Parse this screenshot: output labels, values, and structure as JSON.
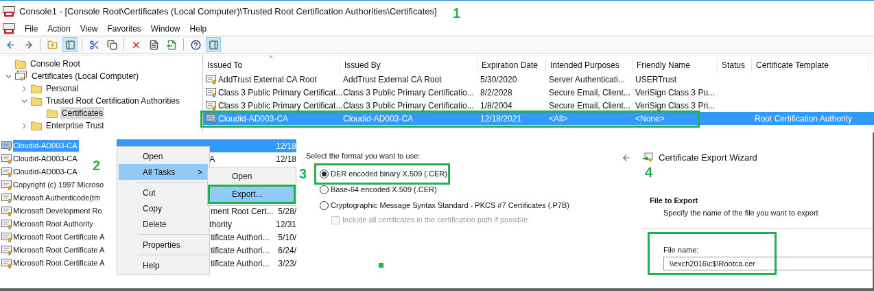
{
  "window": {
    "title": "Console1 - [Console Root\\Certificates (Local Computer)\\Trusted Root Certification Authorities\\Certificates]",
    "step": "1"
  },
  "menu": [
    "File",
    "Action",
    "View",
    "Favorites",
    "Window",
    "Help"
  ],
  "toolbar": [
    {
      "kind": "back",
      "pressed": false
    },
    {
      "kind": "forward",
      "pressed": false
    },
    {
      "kind": "separator"
    },
    {
      "kind": "up",
      "pressed": false
    },
    {
      "kind": "tree",
      "pressed": true
    },
    {
      "kind": "separator"
    },
    {
      "kind": "cut",
      "pressed": false
    },
    {
      "kind": "copy",
      "pressed": false
    },
    {
      "kind": "separator"
    },
    {
      "kind": "delete",
      "pressed": false
    },
    {
      "kind": "properties",
      "pressed": false
    },
    {
      "kind": "export",
      "pressed": false
    },
    {
      "kind": "separator"
    },
    {
      "kind": "help",
      "pressed": false
    },
    {
      "kind": "action-pane",
      "pressed": true
    }
  ],
  "tree": [
    {
      "label": "Console Root",
      "kind": "folder",
      "selected": false
    },
    {
      "label": "Certificates (Local Computer)",
      "kind": "store",
      "expanded": true,
      "selected": false,
      "children": [
        {
          "label": "Personal",
          "kind": "folder",
          "expanded": false,
          "selected": false
        },
        {
          "label": "Trusted Root Certification Authorities",
          "kind": "folder",
          "expanded": true,
          "selected": false,
          "children": [
            {
              "label": "Certificates",
              "kind": "folder",
              "selected": true
            }
          ]
        },
        {
          "label": "Enterprise Trust",
          "kind": "folder",
          "expanded": false,
          "selected": false
        }
      ]
    }
  ],
  "list": {
    "sort_indicator": "^",
    "columns": [
      "Issued To",
      "Issued By",
      "Expiration Date",
      "Intended Purposes",
      "Friendly Name",
      "Status",
      "Certificate Template"
    ],
    "rows": [
      {
        "cells": [
          "AddTrust External CA Root",
          "AddTrust External CA Root",
          "5/30/2020",
          "Server Authenticati...",
          "USERTrust",
          "",
          ""
        ],
        "selected": false,
        "annotated": false
      },
      {
        "cells": [
          "Class 3 Public Primary Certificat...",
          "Class 3 Public Primary Certificatio...",
          "8/2/2028",
          "Secure Email, Client...",
          "VeriSign Class 3 Pu...",
          "",
          ""
        ],
        "selected": false,
        "annotated": false
      },
      {
        "cells": [
          "Class 3 Public Primary Certificat...",
          "Class 3 Public Primary Certificatio...",
          "1/8/2004",
          "Secure Email, Client...",
          "VeriSign Class 3 Pri...",
          "",
          ""
        ],
        "selected": false,
        "annotated": false
      },
      {
        "cells": [
          "Cloudid-AD003-CA",
          "Cloudid-AD003-CA",
          "12/18/2021",
          "<All>",
          "<None>",
          "",
          "Root Certification Authority"
        ],
        "selected": true,
        "annotated": true
      }
    ]
  },
  "context_panel": {
    "step": "2",
    "rows": [
      {
        "issued_to": "Cloudid-AD003-CA",
        "column_2": "",
        "column_3": "12/18",
        "selected": true
      },
      {
        "issued_to": "Cloudid-AD003-CA",
        "column_2": "A",
        "column_3": "12/18",
        "selected": false
      },
      {
        "issued_to": "Cloudid-AD003-CA",
        "column_2": "",
        "column_3": "",
        "selected": false
      },
      {
        "issued_to": "Copyright (c) 1997 Microso",
        "column_2": "",
        "column_3": "",
        "selected": false
      },
      {
        "issued_to": "Microsoft Authenticode(tm",
        "column_2": "",
        "column_3": "",
        "selected": false
      },
      {
        "issued_to": "Microsoft Development Ro",
        "column_2": "ment Root Cert...",
        "column_3": "5/28/",
        "selected": false
      },
      {
        "issued_to": "Microsoft Root Authority",
        "column_2": "thority",
        "column_3": "12/31",
        "selected": false
      },
      {
        "issued_to": "Microsoft Root Certificate A",
        "column_2": "tificate Authori...",
        "column_3": "5/10/",
        "selected": false
      },
      {
        "issued_to": "Microsoft Root Certificate A",
        "column_2": "tificate Authori...",
        "column_3": "6/24/",
        "selected": false
      },
      {
        "issued_to": "Microsoft Root Certificate A",
        "column_2": "tificate Authori...",
        "column_3": "3/23/",
        "selected": false
      }
    ],
    "context_menu": [
      {
        "kind": "command",
        "label": "Open",
        "selected": false
      },
      {
        "kind": "submenu",
        "label": "All Tasks",
        "arrow": ">",
        "selected": true
      },
      {
        "kind": "separator"
      },
      {
        "kind": "command",
        "label": "Cut",
        "selected": false
      },
      {
        "kind": "command",
        "label": "Copy",
        "selected": false
      },
      {
        "kind": "command",
        "label": "Delete",
        "selected": false
      },
      {
        "kind": "separator"
      },
      {
        "kind": "command",
        "label": "Properties",
        "selected": false
      },
      {
        "kind": "separator"
      },
      {
        "kind": "command",
        "label": "Help",
        "selected": false
      }
    ],
    "submenu": [
      {
        "label": "Open",
        "selected": false,
        "annotated": false
      },
      {
        "label": "Export...",
        "selected": true,
        "annotated": true
      }
    ]
  },
  "format_panel": {
    "step": "3",
    "prompt": "Select the format you want to use:",
    "options": [
      {
        "label": "DER encoded binary X.509 (.CER)",
        "selected": true,
        "annotated": true
      },
      {
        "label": "Base-64 encoded X.509 (.CER)",
        "selected": false,
        "annotated": false
      },
      {
        "label": "Cryptographic Message Syntax Standard - PKCS #7 Certificates (.P7B)",
        "selected": false,
        "annotated": false
      }
    ],
    "include_chain": {
      "label": "Include all certificates in the certification path if possible",
      "checked": false,
      "disabled": true
    }
  },
  "wizard_panel": {
    "title": "Certificate Export Wizard",
    "step": "4",
    "heading": "File to Export",
    "description": "Specify the name of the file you want to export",
    "file_field": {
      "label": "File name:",
      "value": "\\\\exch2016\\c$\\Rootca.cer",
      "annotated": true
    }
  }
}
